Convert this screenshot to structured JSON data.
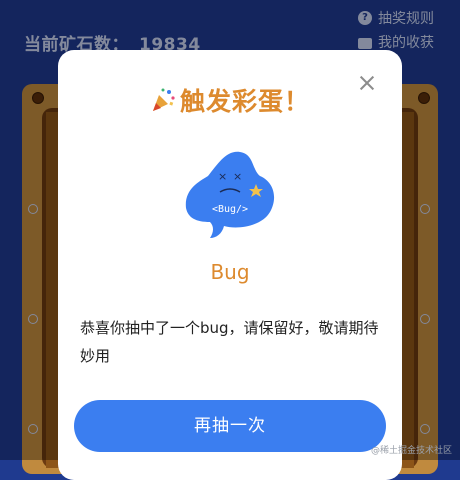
{
  "background": {
    "ore_label": "当前矿石数：",
    "ore_count": "19834",
    "links": [
      {
        "label": "抽奖规则",
        "icon": "help-circle-icon"
      },
      {
        "label": "我的收获",
        "icon": "gift-box-icon"
      }
    ]
  },
  "modal": {
    "title": "触发彩蛋！",
    "title_icon": "party-popper-icon",
    "mascot_tag": "<Bug/>",
    "prize_name": "Bug",
    "prize_desc": "恭喜你抽中了一个bug，请保留好，敬请期待妙用",
    "button_label": "再抽一次"
  },
  "watermark": "@稀土掘金技术社区",
  "colors": {
    "accent": "#dd8a2e",
    "primary": "#3b7ef0",
    "background": "#1f3a8f"
  }
}
